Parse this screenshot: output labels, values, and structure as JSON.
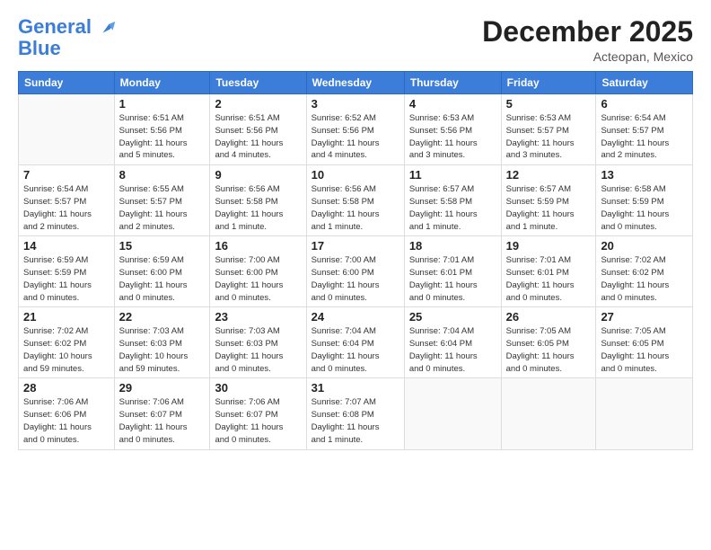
{
  "logo": {
    "line1": "General",
    "line2": "Blue"
  },
  "title": "December 2025",
  "location": "Acteopan, Mexico",
  "days_header": [
    "Sunday",
    "Monday",
    "Tuesday",
    "Wednesday",
    "Thursday",
    "Friday",
    "Saturday"
  ],
  "weeks": [
    [
      {
        "num": "",
        "info": ""
      },
      {
        "num": "1",
        "info": "Sunrise: 6:51 AM\nSunset: 5:56 PM\nDaylight: 11 hours\nand 5 minutes."
      },
      {
        "num": "2",
        "info": "Sunrise: 6:51 AM\nSunset: 5:56 PM\nDaylight: 11 hours\nand 4 minutes."
      },
      {
        "num": "3",
        "info": "Sunrise: 6:52 AM\nSunset: 5:56 PM\nDaylight: 11 hours\nand 4 minutes."
      },
      {
        "num": "4",
        "info": "Sunrise: 6:53 AM\nSunset: 5:56 PM\nDaylight: 11 hours\nand 3 minutes."
      },
      {
        "num": "5",
        "info": "Sunrise: 6:53 AM\nSunset: 5:57 PM\nDaylight: 11 hours\nand 3 minutes."
      },
      {
        "num": "6",
        "info": "Sunrise: 6:54 AM\nSunset: 5:57 PM\nDaylight: 11 hours\nand 2 minutes."
      }
    ],
    [
      {
        "num": "7",
        "info": "Sunrise: 6:54 AM\nSunset: 5:57 PM\nDaylight: 11 hours\nand 2 minutes."
      },
      {
        "num": "8",
        "info": "Sunrise: 6:55 AM\nSunset: 5:57 PM\nDaylight: 11 hours\nand 2 minutes."
      },
      {
        "num": "9",
        "info": "Sunrise: 6:56 AM\nSunset: 5:58 PM\nDaylight: 11 hours\nand 1 minute."
      },
      {
        "num": "10",
        "info": "Sunrise: 6:56 AM\nSunset: 5:58 PM\nDaylight: 11 hours\nand 1 minute."
      },
      {
        "num": "11",
        "info": "Sunrise: 6:57 AM\nSunset: 5:58 PM\nDaylight: 11 hours\nand 1 minute."
      },
      {
        "num": "12",
        "info": "Sunrise: 6:57 AM\nSunset: 5:59 PM\nDaylight: 11 hours\nand 1 minute."
      },
      {
        "num": "13",
        "info": "Sunrise: 6:58 AM\nSunset: 5:59 PM\nDaylight: 11 hours\nand 0 minutes."
      }
    ],
    [
      {
        "num": "14",
        "info": "Sunrise: 6:59 AM\nSunset: 5:59 PM\nDaylight: 11 hours\nand 0 minutes."
      },
      {
        "num": "15",
        "info": "Sunrise: 6:59 AM\nSunset: 6:00 PM\nDaylight: 11 hours\nand 0 minutes."
      },
      {
        "num": "16",
        "info": "Sunrise: 7:00 AM\nSunset: 6:00 PM\nDaylight: 11 hours\nand 0 minutes."
      },
      {
        "num": "17",
        "info": "Sunrise: 7:00 AM\nSunset: 6:00 PM\nDaylight: 11 hours\nand 0 minutes."
      },
      {
        "num": "18",
        "info": "Sunrise: 7:01 AM\nSunset: 6:01 PM\nDaylight: 11 hours\nand 0 minutes."
      },
      {
        "num": "19",
        "info": "Sunrise: 7:01 AM\nSunset: 6:01 PM\nDaylight: 11 hours\nand 0 minutes."
      },
      {
        "num": "20",
        "info": "Sunrise: 7:02 AM\nSunset: 6:02 PM\nDaylight: 11 hours\nand 0 minutes."
      }
    ],
    [
      {
        "num": "21",
        "info": "Sunrise: 7:02 AM\nSunset: 6:02 PM\nDaylight: 10 hours\nand 59 minutes."
      },
      {
        "num": "22",
        "info": "Sunrise: 7:03 AM\nSunset: 6:03 PM\nDaylight: 10 hours\nand 59 minutes."
      },
      {
        "num": "23",
        "info": "Sunrise: 7:03 AM\nSunset: 6:03 PM\nDaylight: 11 hours\nand 0 minutes."
      },
      {
        "num": "24",
        "info": "Sunrise: 7:04 AM\nSunset: 6:04 PM\nDaylight: 11 hours\nand 0 minutes."
      },
      {
        "num": "25",
        "info": "Sunrise: 7:04 AM\nSunset: 6:04 PM\nDaylight: 11 hours\nand 0 minutes."
      },
      {
        "num": "26",
        "info": "Sunrise: 7:05 AM\nSunset: 6:05 PM\nDaylight: 11 hours\nand 0 minutes."
      },
      {
        "num": "27",
        "info": "Sunrise: 7:05 AM\nSunset: 6:05 PM\nDaylight: 11 hours\nand 0 minutes."
      }
    ],
    [
      {
        "num": "28",
        "info": "Sunrise: 7:06 AM\nSunset: 6:06 PM\nDaylight: 11 hours\nand 0 minutes."
      },
      {
        "num": "29",
        "info": "Sunrise: 7:06 AM\nSunset: 6:07 PM\nDaylight: 11 hours\nand 0 minutes."
      },
      {
        "num": "30",
        "info": "Sunrise: 7:06 AM\nSunset: 6:07 PM\nDaylight: 11 hours\nand 0 minutes."
      },
      {
        "num": "31",
        "info": "Sunrise: 7:07 AM\nSunset: 6:08 PM\nDaylight: 11 hours\nand 1 minute."
      },
      {
        "num": "",
        "info": ""
      },
      {
        "num": "",
        "info": ""
      },
      {
        "num": "",
        "info": ""
      }
    ]
  ]
}
